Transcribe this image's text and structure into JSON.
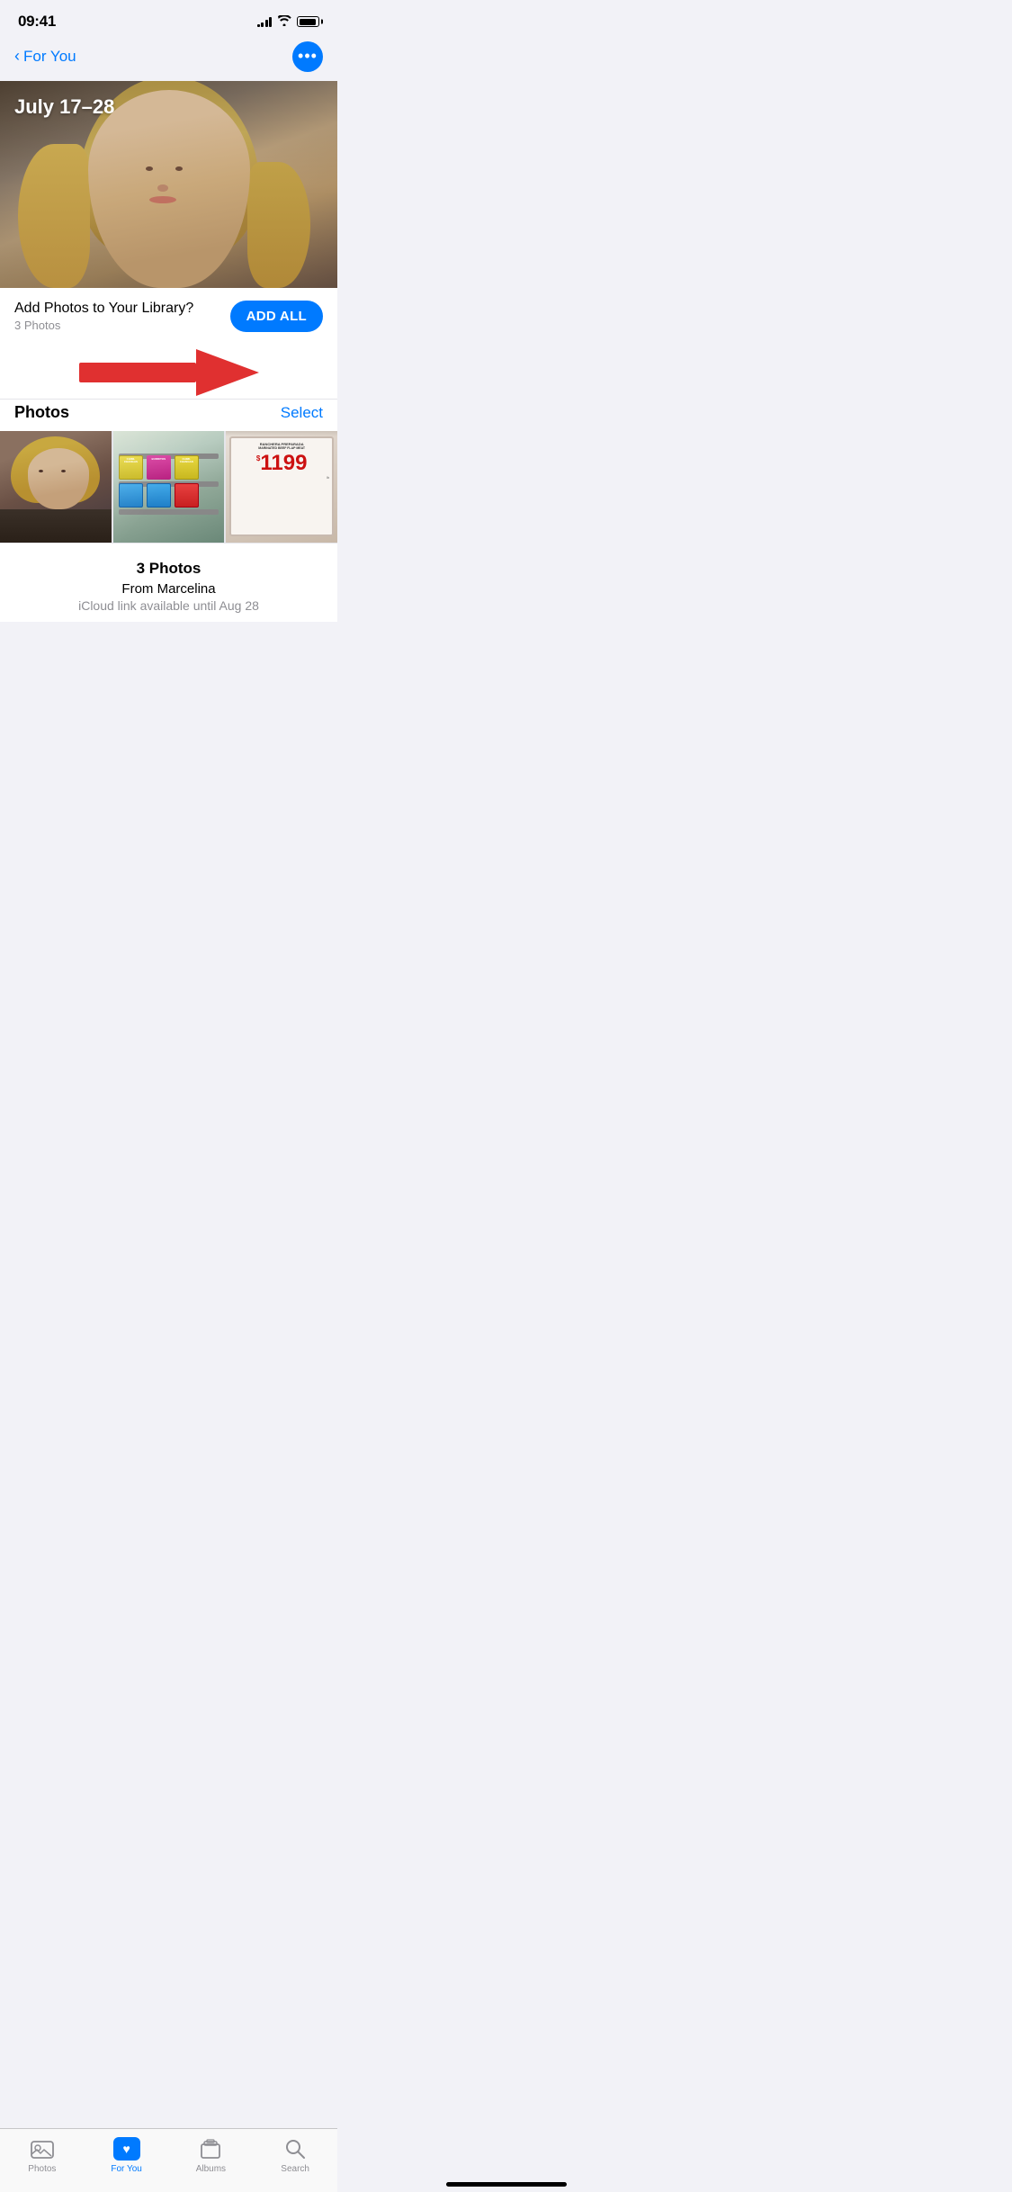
{
  "statusBar": {
    "time": "09:41"
  },
  "nav": {
    "backLabel": "For You",
    "moreLabel": "···"
  },
  "hero": {
    "dateRange": "July 17–28"
  },
  "addPhotos": {
    "title": "Add Photos to Your Library?",
    "subtitle": "3 Photos",
    "addAllLabel": "ADD ALL"
  },
  "photosSection": {
    "label": "Photos",
    "selectLabel": "Select"
  },
  "photoInfo": {
    "count": "3 Photos",
    "from": "From Marcelina",
    "linkExpiry": "iCloud link available until Aug 28"
  },
  "tabBar": {
    "items": [
      {
        "id": "photos",
        "label": "Photos",
        "active": false
      },
      {
        "id": "for-you",
        "label": "For You",
        "active": true
      },
      {
        "id": "albums",
        "label": "Albums",
        "active": false
      },
      {
        "id": "search",
        "label": "Search",
        "active": false
      }
    ]
  },
  "priceTag": {
    "line1": "RANCHERA PREPARADA",
    "line2": "MARINATED BEEF FLAP MEAT",
    "price": "1199",
    "dollar": "$"
  },
  "frozenFood": {
    "brands": [
      "CHIMICHANGAS",
      "BURRITOS",
      "CHIMICHANGAS"
    ]
  }
}
